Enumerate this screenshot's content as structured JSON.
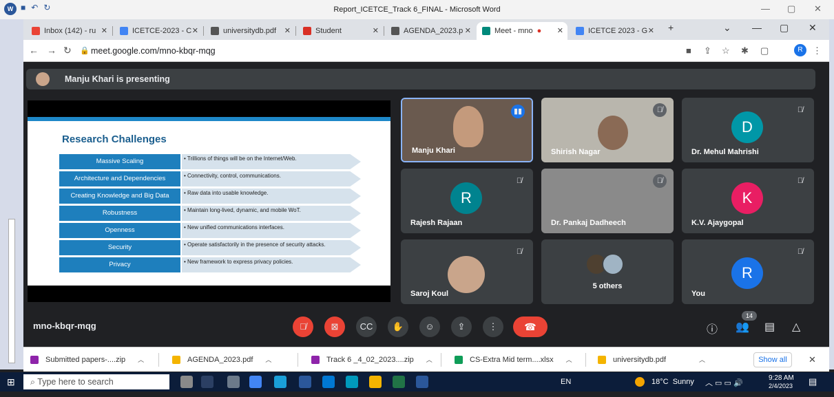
{
  "word": {
    "title": "Report_ICETCE_Track 6_FINAL - Microsoft Word",
    "window_controls": [
      "—",
      "▢",
      "✕"
    ]
  },
  "browser": {
    "tabs": [
      {
        "label": "Inbox (142) - ru",
        "color": "#ea4335"
      },
      {
        "label": "ICETCE-2023 - C",
        "color": "#4285f4"
      },
      {
        "label": "universitydb.pdf",
        "color": "#555555"
      },
      {
        "label": "Student",
        "color": "#d93025"
      },
      {
        "label": "AGENDA_2023.p",
        "color": "#555555"
      },
      {
        "label": "Meet - mno",
        "color": "#00897b"
      },
      {
        "label": "ICETCE 2023 - G",
        "color": "#4285f4"
      }
    ],
    "url": "meet.google.com/mno-kbqr-mqg",
    "profile_initial": "R",
    "new_tab": "+",
    "controls": [
      "⌄",
      "—",
      "▢",
      "✕"
    ]
  },
  "meet": {
    "presenting_text": "Manju Khari is presenting",
    "meeting_code": "mno-kbqr-mqg",
    "participant_count": "14",
    "slide": {
      "title": "Research Challenges",
      "rows": [
        {
          "label": "Massive Scaling",
          "desc": "• Trillions of things will be on the Internet/Web."
        },
        {
          "label": "Architecture and Dependencies",
          "desc": "• Connectivity, control, communications."
        },
        {
          "label": "Creating Knowledge and Big Data",
          "desc": "• Raw data into usable knowledge."
        },
        {
          "label": "Robustness",
          "desc": "• Maintain long-lived, dynamic, and mobile WoT."
        },
        {
          "label": "Openness",
          "desc": "• New unified communications interfaces."
        },
        {
          "label": "Security",
          "desc": "• Operate satisfactorily in the presence of security attacks."
        },
        {
          "label": "Privacy",
          "desc": "• New framework to express privacy policies."
        }
      ]
    },
    "tiles": [
      {
        "name": "Manju Khari",
        "initial": "",
        "bg": "#6a5a4f"
      },
      {
        "name": "Shirish Nagar",
        "initial": "",
        "bg": "#8a8780"
      },
      {
        "name": "Dr. Mehul Mahrishi",
        "initial": "D",
        "bg": "#0097a7"
      },
      {
        "name": "Rajesh Rajaan",
        "initial": "R",
        "bg": "#00838f"
      },
      {
        "name": "Dr. Pankaj Dadheech",
        "initial": "",
        "bg": "#8a8a8a"
      },
      {
        "name": "K.V. Ajaygopal",
        "initial": "K",
        "bg": "#e91e63"
      },
      {
        "name": "Saroj Koul",
        "initial": "",
        "bg": "#c9a58b"
      },
      {
        "name": "5 others",
        "initial": "",
        "bg": "#5f6368"
      },
      {
        "name": "You",
        "initial": "R",
        "bg": "#1a73e8"
      }
    ]
  },
  "downloads": [
    {
      "label": "Submitted papers-....zip",
      "color": "#8e24aa"
    },
    {
      "label": "AGENDA_2023.pdf",
      "color": "#f4b400"
    },
    {
      "label": "Track 6 _4_02_2023....zip",
      "color": "#8e24aa"
    },
    {
      "label": "CS-Extra Mid term....xlsx",
      "color": "#0f9d58"
    },
    {
      "label": "universitydb.pdf",
      "color": "#f4b400"
    }
  ],
  "downloads_show_all": "Show all",
  "taskbar": {
    "search_placeholder": "Type here to search",
    "language": "EN",
    "weather": "18°C  Sunny",
    "time": "9:28 AM",
    "date": "2/4/2023"
  }
}
